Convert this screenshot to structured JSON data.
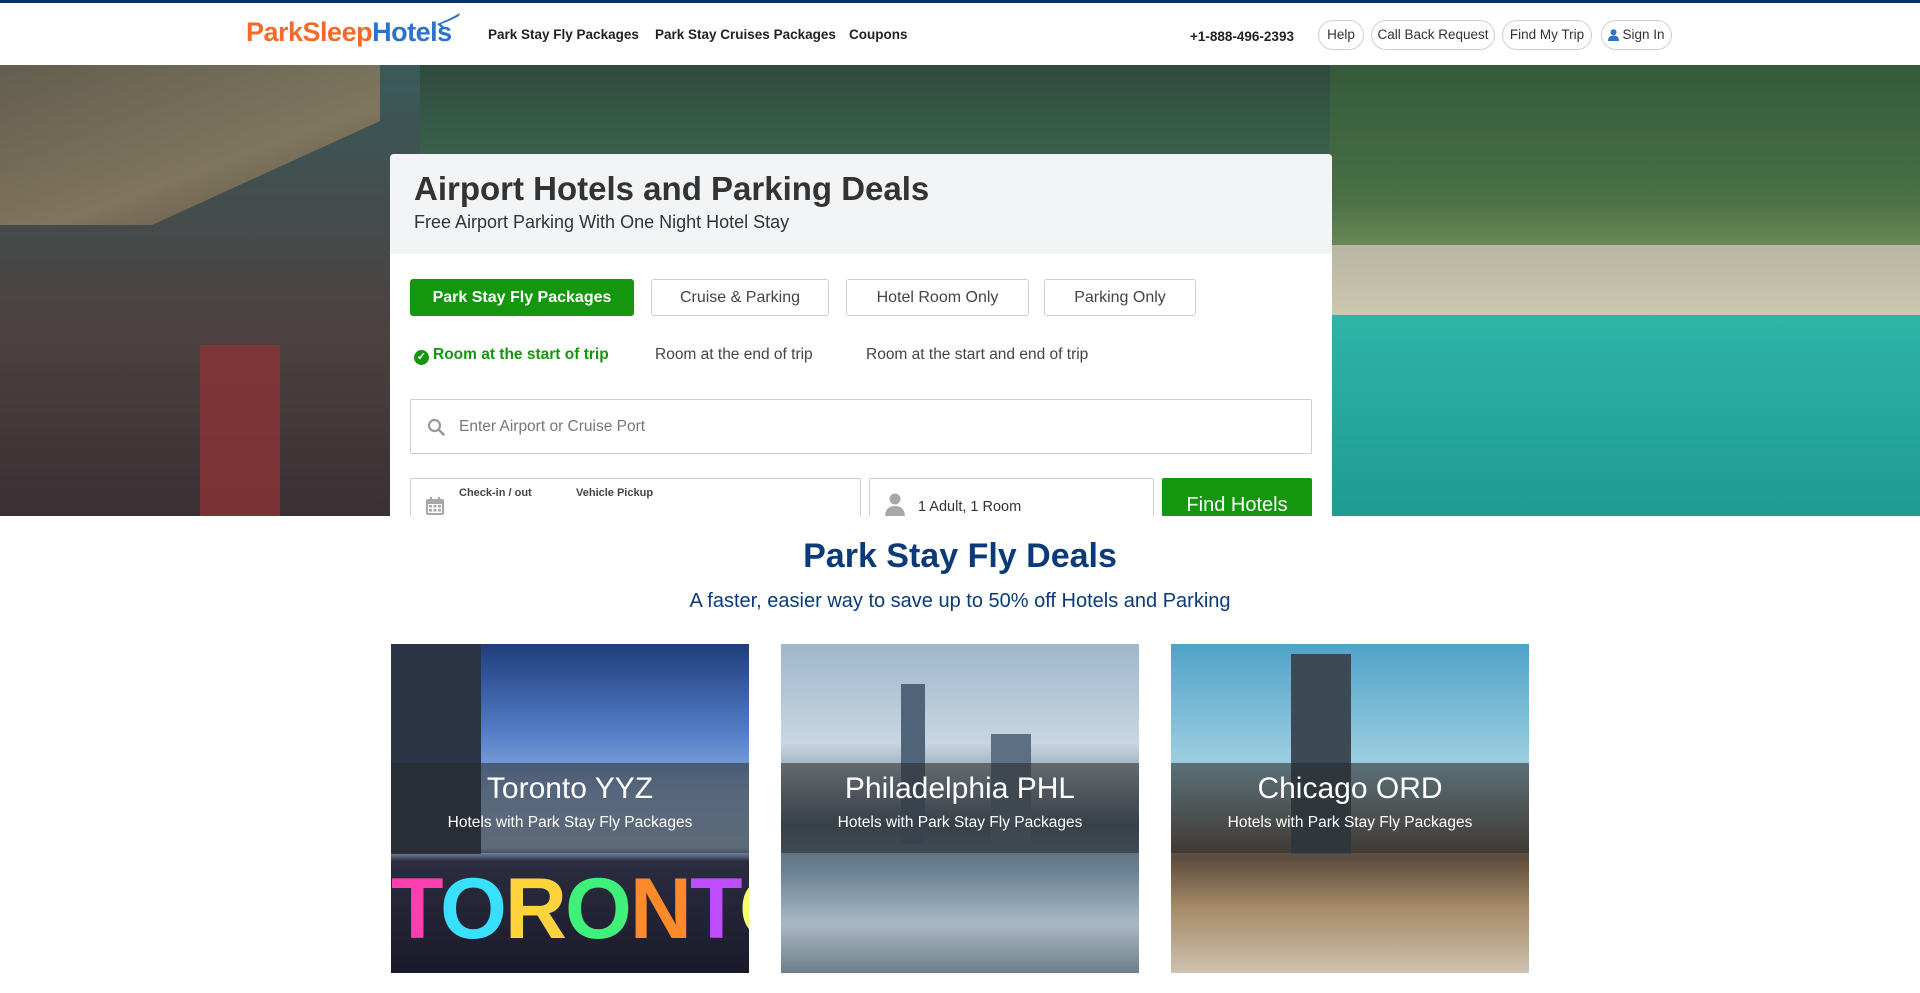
{
  "header": {
    "logo_part1": "ParkSleep",
    "logo_part2": "Hotels",
    "nav": [
      "Park Stay Fly Packages",
      "Park Stay Cruises Packages",
      "Coupons"
    ],
    "phone": "+1-888-496-2393",
    "help": "Help",
    "callback": "Call Back Request",
    "find_trip": "Find My Trip",
    "sign_in": "Sign In"
  },
  "search_card": {
    "title": "Airport Hotels and Parking Deals",
    "subtitle": "Free Airport Parking With One Night Hotel Stay",
    "tabs": [
      "Park Stay Fly Packages",
      "Cruise & Parking",
      "Hotel Room Only",
      "Parking Only"
    ],
    "active_tab": "Park Stay Fly Packages",
    "room_options": [
      "Room at the start of trip",
      "Room at the end of trip",
      "Room at the start and end of trip"
    ],
    "active_option": "Room at the start of trip",
    "search_placeholder": "Enter Airport or Cruise Port",
    "checkin_label": "Check-in / out",
    "pickup_label": "Vehicle Pickup",
    "guests_value": "1 Adult,  1 Room",
    "find_button": "Find Hotels"
  },
  "deals": {
    "title": "Park Stay Fly Deals",
    "subtitle": "A faster, easier way to save up to 50% off Hotels and Parking",
    "cities": [
      {
        "name": "Toronto YYZ",
        "tagline": "Hotels with Park Stay Fly Packages",
        "sign_text": "TORONTO"
      },
      {
        "name": "Philadelphia PHL",
        "tagline": "Hotels with Park Stay Fly Packages"
      },
      {
        "name": "Chicago ORD",
        "tagline": "Hotels with Park Stay Fly Packages"
      }
    ]
  },
  "colors": {
    "brand_orange": "#f26b2a",
    "brand_blue": "#2b74c9",
    "primary_green": "#14970f",
    "heading_navy": "#0b3a7a",
    "top_border": "#0b2f6b"
  },
  "icons": {
    "logo": "airplane-icon",
    "sign_in": "user-icon",
    "search": "search-icon",
    "dates": "calendar-icon",
    "guests": "person-icon",
    "active_option": "check-circle-icon"
  }
}
